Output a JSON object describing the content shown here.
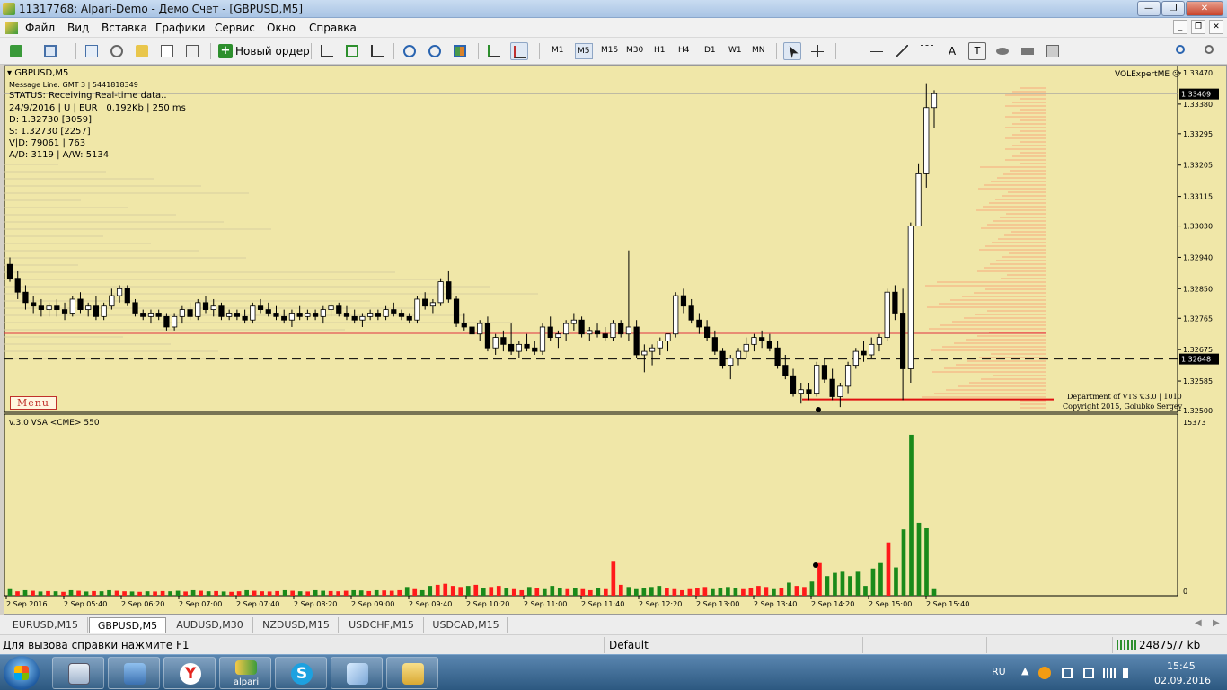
{
  "window": {
    "title": "11317768: Alpari-Demo - Демо Счет - [GBPUSD,M5]"
  },
  "menu": [
    "Файл",
    "Вид",
    "Вставка",
    "Графики",
    "Сервис",
    "Окно",
    "Справка"
  ],
  "toolbar": {
    "new_order": "Новый ордер",
    "timeframes": [
      "M1",
      "M5",
      "M15",
      "M30",
      "H1",
      "H4",
      "D1",
      "W1",
      "MN"
    ],
    "active_timeframe": "M5",
    "text_tool": "A",
    "label_tool": "T"
  },
  "chart": {
    "symbol_title": "GBPUSD,M5",
    "info_lines": [
      "Message Line: GMT 3 | 5441818349",
      "STATUS:  Receiving Real-time data..",
      "24/9/2016 | U | EUR | 0.192Kb | 250 ms",
      "D: 1.32730  [3059]",
      "S: 1.32730  [2257]",
      "V|D: 79061 | 763",
      "A/D: 3119 | A/W: 5134"
    ],
    "expert_label": "VOLExpertME",
    "menu_button": "Menu",
    "copyright_1": "Department of VTS  v.3.0 | 1010",
    "copyright_2": "Copyright 2015, Golubko Sergey",
    "indicator_label": "v.3.0 VSA <CME> 550",
    "volume_scale_max": "15373",
    "volume_scale_min": "0",
    "current_price": "1.33409",
    "line_price": "1.32648",
    "colors": {
      "background": "#f0e7a8",
      "bull": "#ffffff",
      "bear": "#000000",
      "vol_up": "#1a8a1a",
      "vol_down": "#ff1a1a",
      "profile": "#ff8060",
      "level": "#e03040"
    }
  },
  "chart_data": {
    "type": "candlestick",
    "price_axis_labels": [
      "1.33470",
      "1.33380",
      "1.33295",
      "1.33205",
      "1.33115",
      "1.33030",
      "1.32940",
      "1.32850",
      "1.32765",
      "1.32675",
      "1.32585",
      "1.32500"
    ],
    "price_range": [
      1.325,
      1.3347
    ],
    "time_labels": [
      "2 Sep 2016",
      "2 Sep 05:40",
      "2 Sep 06:20",
      "2 Sep 07:00",
      "2 Sep 07:40",
      "2 Sep 08:20",
      "2 Sep 09:00",
      "2 Sep 09:40",
      "2 Sep 10:20",
      "2 Sep 11:00",
      "2 Sep 11:40",
      "2 Sep 12:20",
      "2 Sep 13:00",
      "2 Sep 13:40",
      "2 Sep 14:20",
      "2 Sep 15:00",
      "2 Sep 15:40"
    ],
    "volume_range": [
      0,
      15373
    ],
    "candles": [
      [
        1.3292,
        1.3294,
        1.3287,
        1.3288
      ],
      [
        1.3288,
        1.329,
        1.3282,
        1.3284
      ],
      [
        1.3284,
        1.3286,
        1.3279,
        1.3281
      ],
      [
        1.3281,
        1.3283,
        1.3278,
        1.328
      ],
      [
        1.328,
        1.3282,
        1.3277,
        1.3279
      ],
      [
        1.3279,
        1.3281,
        1.3277,
        1.328
      ],
      [
        1.328,
        1.3282,
        1.3277,
        1.3279
      ],
      [
        1.3279,
        1.3281,
        1.3276,
        1.3278
      ],
      [
        1.3278,
        1.3283,
        1.3277,
        1.3282
      ],
      [
        1.3282,
        1.3284,
        1.3278,
        1.3279
      ],
      [
        1.3279,
        1.3281,
        1.3277,
        1.328
      ],
      [
        1.328,
        1.3283,
        1.3276,
        1.3277
      ],
      [
        1.3277,
        1.3281,
        1.3276,
        1.328
      ],
      [
        1.328,
        1.3285,
        1.3279,
        1.3283
      ],
      [
        1.3283,
        1.3286,
        1.3281,
        1.3285
      ],
      [
        1.3285,
        1.3286,
        1.328,
        1.3281
      ],
      [
        1.3281,
        1.3282,
        1.3277,
        1.3278
      ],
      [
        1.3278,
        1.3279,
        1.3276,
        1.3277
      ],
      [
        1.3277,
        1.3279,
        1.3275,
        1.3278
      ],
      [
        1.3278,
        1.3279,
        1.3276,
        1.3277
      ],
      [
        1.3277,
        1.3278,
        1.3273,
        1.3274
      ],
      [
        1.3274,
        1.3278,
        1.3273,
        1.3277
      ],
      [
        1.3277,
        1.328,
        1.3275,
        1.3279
      ],
      [
        1.3279,
        1.3281,
        1.3276,
        1.3277
      ],
      [
        1.3277,
        1.3282,
        1.3276,
        1.3281
      ],
      [
        1.3281,
        1.3283,
        1.3278,
        1.3279
      ],
      [
        1.3279,
        1.3282,
        1.3277,
        1.328
      ],
      [
        1.328,
        1.3281,
        1.3276,
        1.3277
      ],
      [
        1.3277,
        1.3279,
        1.3276,
        1.3278
      ],
      [
        1.3278,
        1.3279,
        1.3276,
        1.3277
      ],
      [
        1.3277,
        1.3279,
        1.3275,
        1.3276
      ],
      [
        1.3276,
        1.3281,
        1.3275,
        1.328
      ],
      [
        1.328,
        1.3282,
        1.3278,
        1.3279
      ],
      [
        1.3279,
        1.3281,
        1.3277,
        1.3278
      ],
      [
        1.3278,
        1.328,
        1.3276,
        1.3277
      ],
      [
        1.3277,
        1.3279,
        1.3275,
        1.3276
      ],
      [
        1.3276,
        1.3279,
        1.3274,
        1.3278
      ],
      [
        1.3278,
        1.328,
        1.3276,
        1.3277
      ],
      [
        1.3277,
        1.3279,
        1.3276,
        1.3278
      ],
      [
        1.3278,
        1.3279,
        1.3276,
        1.3277
      ],
      [
        1.3277,
        1.328,
        1.3275,
        1.3279
      ],
      [
        1.3279,
        1.3281,
        1.3277,
        1.328
      ],
      [
        1.328,
        1.3281,
        1.3277,
        1.3278
      ],
      [
        1.3278,
        1.328,
        1.3276,
        1.3277
      ],
      [
        1.3277,
        1.3279,
        1.3275,
        1.3276
      ],
      [
        1.3276,
        1.3278,
        1.3274,
        1.3277
      ],
      [
        1.3277,
        1.3279,
        1.3276,
        1.3278
      ],
      [
        1.3278,
        1.3279,
        1.3276,
        1.3277
      ],
      [
        1.3277,
        1.328,
        1.3276,
        1.3279
      ],
      [
        1.3279,
        1.3281,
        1.3277,
        1.3278
      ],
      [
        1.3278,
        1.3279,
        1.3276,
        1.3277
      ],
      [
        1.3277,
        1.3278,
        1.3275,
        1.3276
      ],
      [
        1.3276,
        1.3283,
        1.3275,
        1.3282
      ],
      [
        1.3282,
        1.3284,
        1.3279,
        1.328
      ],
      [
        1.328,
        1.3282,
        1.3278,
        1.3281
      ],
      [
        1.3281,
        1.3288,
        1.328,
        1.3287
      ],
      [
        1.3287,
        1.329,
        1.3281,
        1.3282
      ],
      [
        1.3282,
        1.3283,
        1.3274,
        1.3275
      ],
      [
        1.3275,
        1.3278,
        1.3273,
        1.3274
      ],
      [
        1.3274,
        1.3276,
        1.3271,
        1.3272
      ],
      [
        1.3272,
        1.3276,
        1.327,
        1.3275
      ],
      [
        1.3275,
        1.3277,
        1.3267,
        1.3268
      ],
      [
        1.3268,
        1.3272,
        1.3266,
        1.3271
      ],
      [
        1.3271,
        1.3273,
        1.3267,
        1.3269
      ],
      [
        1.3269,
        1.3275,
        1.3266,
        1.3267
      ],
      [
        1.3267,
        1.327,
        1.3265,
        1.3269
      ],
      [
        1.3269,
        1.3272,
        1.3267,
        1.3268
      ],
      [
        1.3268,
        1.327,
        1.3266,
        1.3267
      ],
      [
        1.3267,
        1.3275,
        1.3266,
        1.3274
      ],
      [
        1.3274,
        1.3277,
        1.327,
        1.3271
      ],
      [
        1.3271,
        1.3273,
        1.3268,
        1.3272
      ],
      [
        1.3272,
        1.3276,
        1.327,
        1.3275
      ],
      [
        1.3275,
        1.3278,
        1.3273,
        1.3276
      ],
      [
        1.3276,
        1.3277,
        1.3271,
        1.3272
      ],
      [
        1.3272,
        1.3274,
        1.327,
        1.3273
      ],
      [
        1.3273,
        1.3275,
        1.3271,
        1.3272
      ],
      [
        1.3272,
        1.3274,
        1.327,
        1.3271
      ],
      [
        1.3271,
        1.3276,
        1.327,
        1.3275
      ],
      [
        1.3275,
        1.3276,
        1.3271,
        1.3272
      ],
      [
        1.3272,
        1.3296,
        1.327,
        1.3274
      ],
      [
        1.3274,
        1.3276,
        1.3265,
        1.3266
      ],
      [
        1.3266,
        1.3269,
        1.3261,
        1.3267
      ],
      [
        1.3267,
        1.3269,
        1.3263,
        1.3268
      ],
      [
        1.3268,
        1.3271,
        1.3266,
        1.327
      ],
      [
        1.327,
        1.3272,
        1.3267,
        1.3272
      ],
      [
        1.3272,
        1.3284,
        1.3271,
        1.3283
      ],
      [
        1.3283,
        1.3285,
        1.3278,
        1.328
      ],
      [
        1.328,
        1.3282,
        1.3275,
        1.3276
      ],
      [
        1.3276,
        1.3278,
        1.3272,
        1.3274
      ],
      [
        1.3274,
        1.3276,
        1.327,
        1.3271
      ],
      [
        1.3271,
        1.3273,
        1.3266,
        1.3267
      ],
      [
        1.3267,
        1.3268,
        1.3262,
        1.3263
      ],
      [
        1.3263,
        1.3266,
        1.3259,
        1.3265
      ],
      [
        1.3265,
        1.3268,
        1.3263,
        1.3267
      ],
      [
        1.3267,
        1.3271,
        1.3265,
        1.3269
      ],
      [
        1.3269,
        1.3272,
        1.3267,
        1.3271
      ],
      [
        1.3271,
        1.3273,
        1.3268,
        1.327
      ],
      [
        1.327,
        1.3272,
        1.3267,
        1.3268
      ],
      [
        1.3268,
        1.327,
        1.3262,
        1.3263
      ],
      [
        1.3263,
        1.3266,
        1.3259,
        1.326
      ],
      [
        1.326,
        1.3262,
        1.3254,
        1.3255
      ],
      [
        1.3255,
        1.3258,
        1.3252,
        1.3256
      ],
      [
        1.3256,
        1.3258,
        1.3253,
        1.3255
      ],
      [
        1.3255,
        1.3264,
        1.3254,
        1.3263
      ],
      [
        1.3263,
        1.3265,
        1.3258,
        1.3259
      ],
      [
        1.3259,
        1.3262,
        1.3253,
        1.3254
      ],
      [
        1.3254,
        1.3258,
        1.3251,
        1.3257
      ],
      [
        1.3257,
        1.3264,
        1.3255,
        1.3263
      ],
      [
        1.3263,
        1.3268,
        1.3262,
        1.3267
      ],
      [
        1.3267,
        1.327,
        1.3264,
        1.3266
      ],
      [
        1.3266,
        1.3271,
        1.3265,
        1.3269
      ],
      [
        1.3269,
        1.3272,
        1.3267,
        1.3271
      ],
      [
        1.3271,
        1.3285,
        1.327,
        1.3284
      ],
      [
        1.3284,
        1.3286,
        1.3276,
        1.3278
      ],
      [
        1.3278,
        1.3285,
        1.3253,
        1.3262
      ],
      [
        1.3262,
        1.3304,
        1.3258,
        1.3303
      ],
      [
        1.3303,
        1.3321,
        1.3311,
        1.3318
      ],
      [
        1.3318,
        1.3344,
        1.3314,
        1.3337
      ],
      [
        1.3337,
        1.3342,
        1.3331,
        1.3341
      ]
    ],
    "volumes": [
      [
        600,
        "u"
      ],
      [
        400,
        "d"
      ],
      [
        500,
        "u"
      ],
      [
        450,
        "d"
      ],
      [
        380,
        "u"
      ],
      [
        420,
        "d"
      ],
      [
        400,
        "u"
      ],
      [
        350,
        "d"
      ],
      [
        500,
        "u"
      ],
      [
        450,
        "d"
      ],
      [
        380,
        "u"
      ],
      [
        420,
        "d"
      ],
      [
        400,
        "u"
      ],
      [
        500,
        "u"
      ],
      [
        450,
        "d"
      ],
      [
        400,
        "d"
      ],
      [
        380,
        "u"
      ],
      [
        350,
        "d"
      ],
      [
        400,
        "u"
      ],
      [
        380,
        "d"
      ],
      [
        420,
        "d"
      ],
      [
        400,
        "u"
      ],
      [
        450,
        "u"
      ],
      [
        380,
        "d"
      ],
      [
        500,
        "u"
      ],
      [
        450,
        "d"
      ],
      [
        400,
        "u"
      ],
      [
        420,
        "d"
      ],
      [
        380,
        "u"
      ],
      [
        350,
        "d"
      ],
      [
        400,
        "d"
      ],
      [
        500,
        "u"
      ],
      [
        450,
        "d"
      ],
      [
        400,
        "d"
      ],
      [
        380,
        "d"
      ],
      [
        420,
        "d"
      ],
      [
        500,
        "u"
      ],
      [
        450,
        "d"
      ],
      [
        400,
        "u"
      ],
      [
        380,
        "d"
      ],
      [
        500,
        "u"
      ],
      [
        450,
        "u"
      ],
      [
        420,
        "d"
      ],
      [
        400,
        "d"
      ],
      [
        450,
        "d"
      ],
      [
        500,
        "u"
      ],
      [
        480,
        "u"
      ],
      [
        420,
        "d"
      ],
      [
        500,
        "u"
      ],
      [
        480,
        "d"
      ],
      [
        450,
        "d"
      ],
      [
        500,
        "d"
      ],
      [
        800,
        "u"
      ],
      [
        600,
        "d"
      ],
      [
        500,
        "u"
      ],
      [
        900,
        "u"
      ],
      [
        1000,
        "d"
      ],
      [
        1100,
        "d"
      ],
      [
        900,
        "d"
      ],
      [
        800,
        "d"
      ],
      [
        900,
        "u"
      ],
      [
        1000,
        "d"
      ],
      [
        700,
        "u"
      ],
      [
        800,
        "d"
      ],
      [
        900,
        "d"
      ],
      [
        700,
        "u"
      ],
      [
        600,
        "d"
      ],
      [
        500,
        "d"
      ],
      [
        800,
        "u"
      ],
      [
        700,
        "d"
      ],
      [
        600,
        "u"
      ],
      [
        900,
        "u"
      ],
      [
        700,
        "u"
      ],
      [
        600,
        "d"
      ],
      [
        700,
        "u"
      ],
      [
        600,
        "d"
      ],
      [
        500,
        "d"
      ],
      [
        700,
        "u"
      ],
      [
        600,
        "d"
      ],
      [
        3200,
        "d"
      ],
      [
        1000,
        "d"
      ],
      [
        800,
        "u"
      ],
      [
        600,
        "u"
      ],
      [
        700,
        "u"
      ],
      [
        800,
        "u"
      ],
      [
        900,
        "u"
      ],
      [
        700,
        "d"
      ],
      [
        600,
        "d"
      ],
      [
        500,
        "d"
      ],
      [
        600,
        "d"
      ],
      [
        700,
        "d"
      ],
      [
        800,
        "d"
      ],
      [
        600,
        "u"
      ],
      [
        700,
        "u"
      ],
      [
        800,
        "u"
      ],
      [
        700,
        "u"
      ],
      [
        600,
        "d"
      ],
      [
        700,
        "d"
      ],
      [
        900,
        "d"
      ],
      [
        800,
        "d"
      ],
      [
        600,
        "u"
      ],
      [
        700,
        "d"
      ],
      [
        1200,
        "u"
      ],
      [
        900,
        "d"
      ],
      [
        800,
        "d"
      ],
      [
        1300,
        "u"
      ],
      [
        3000,
        "d"
      ],
      [
        1800,
        "u"
      ],
      [
        2100,
        "u"
      ],
      [
        2200,
        "u"
      ],
      [
        1800,
        "u"
      ],
      [
        2200,
        "u"
      ],
      [
        900,
        "u"
      ],
      [
        2500,
        "u"
      ],
      [
        3000,
        "u"
      ],
      [
        4900,
        "d"
      ],
      [
        2600,
        "u"
      ],
      [
        6100,
        "u"
      ],
      [
        14800,
        "u"
      ],
      [
        6700,
        "u"
      ],
      [
        6200,
        "u"
      ],
      [
        600,
        "u"
      ]
    ]
  },
  "tabs": [
    "EURUSD,M15",
    "GBPUSD,M5",
    "AUDUSD,M30",
    "NZDUSD,M15",
    "USDCHF,M15",
    "USDCAD,M15"
  ],
  "active_tab": "GBPUSD,M5",
  "status": {
    "help": "Для вызова справки нажмите F1",
    "profile": "Default",
    "connection": "24875/7 kb"
  },
  "taskbar": {
    "apps": [
      "calculator",
      "windows-explorer",
      "yandex-browser",
      "alpari",
      "skype",
      "notepad",
      "folder"
    ],
    "alpari_label": "alpari",
    "language": "RU",
    "time": "15:45",
    "date": "02.09.2016"
  }
}
